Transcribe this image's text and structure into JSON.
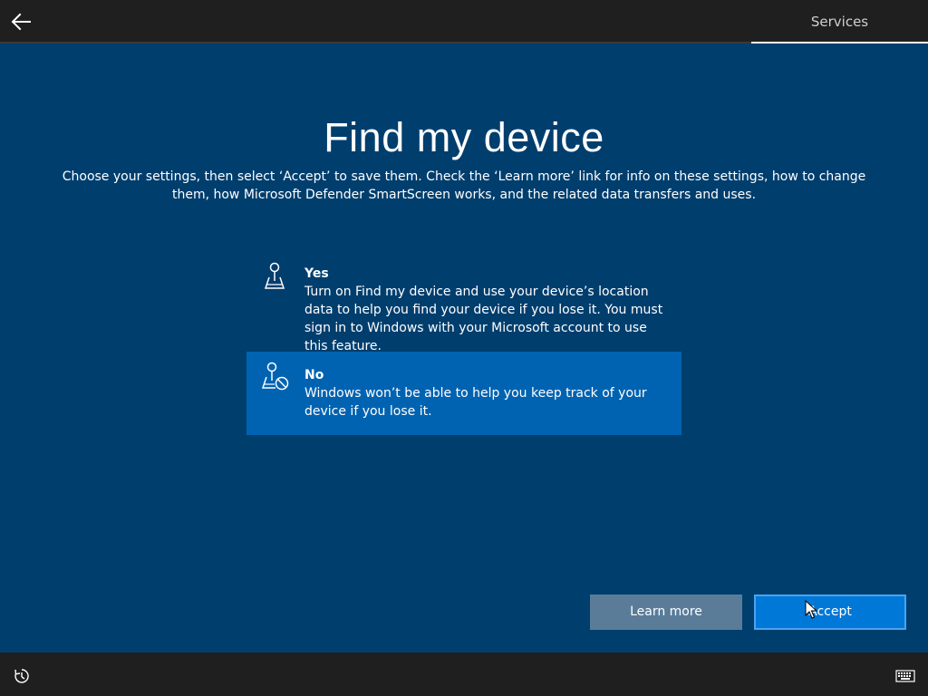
{
  "topbar": {
    "back_icon": "back-arrow-icon",
    "tab_label": "Services"
  },
  "page": {
    "title": "Find my device",
    "subtitle": "Choose your settings, then select ‘Accept’ to save them. Check the ‘Learn more’ link for info on these settings, how to change them, how Microsoft Defender SmartScreen works, and the related data transfers and uses."
  },
  "options": [
    {
      "title": "Yes",
      "description": "Turn on Find my device and use your device’s location data to help you find your device if you lose it. You must sign in to Windows with your Microsoft account to use this feature.",
      "icon": "map-pin-icon",
      "selected": false
    },
    {
      "title": "No",
      "description": "Windows won’t be able to help you keep track of your device if you lose it.",
      "icon": "map-pin-blocked-icon",
      "selected": true
    }
  ],
  "buttons": {
    "learn_more": "Learn more",
    "accept": "Accept"
  },
  "bottombar": {
    "ease_icon": "ease-of-access-icon",
    "keyboard_icon": "keyboard-icon"
  },
  "colors": {
    "background": "#003e6e",
    "bar": "#1f1f1f",
    "selected_option": "#0063b1",
    "accent": "#0078d7",
    "secondary_button": "#5a7c99"
  }
}
